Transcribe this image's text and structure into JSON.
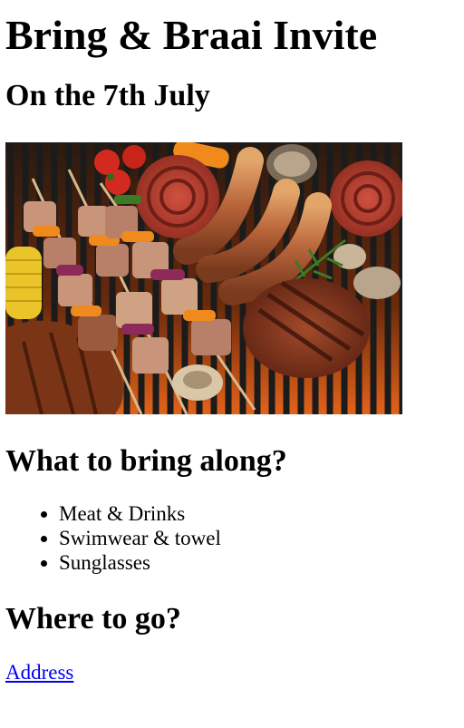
{
  "page": {
    "title": "Bring & Braai Invite",
    "date_heading": "On the 7th July",
    "bring_heading": "What to bring along?",
    "bring_items": [
      "Meat & Drinks",
      "Swimwear & towel",
      "Sunglasses"
    ],
    "where_heading": "Where to go?",
    "address_link": "Address"
  },
  "image": {
    "subject": "braai-grill-photo",
    "colors": {
      "grill_dark": "#1b1b1b",
      "ember": "#e2621a",
      "sausage": "#b5543a",
      "boerewors": "#c0392b",
      "steak": "#8e3b22",
      "pepper_orange": "#f08a1c",
      "tomato": "#d22a1f"
    }
  },
  "colors": {
    "link": "#0000ee",
    "text": "#000000",
    "background": "#ffffff"
  }
}
